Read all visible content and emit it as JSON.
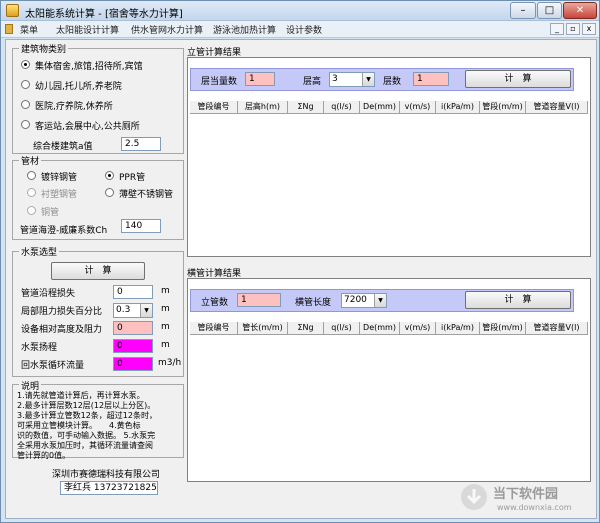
{
  "window": {
    "title": "太阳能系统计算 - [宿舍等水力计算]",
    "min": "–",
    "max": "□",
    "close": "✕"
  },
  "menu": [
    "菜单",
    "太阳能设计计算",
    "供水管网水力计算",
    "游泳池加热计算",
    "设计参数"
  ],
  "mdi": {
    "min": "_",
    "restore": "▫",
    "close": "x"
  },
  "building": {
    "title": "建筑物类别",
    "options": [
      "集体宿舍,旅馆,招待所,宾馆",
      "幼儿园,托儿所,养老院",
      "医院,疗养院,休养所",
      "客运站,会展中心,公共厕所"
    ],
    "selected": 0,
    "alpha_label": "综合楼建筑a值",
    "alpha_value": "2.5"
  },
  "pipe": {
    "title": "管材",
    "options": [
      "镀锌钢管",
      "PPR管",
      "衬塑钢管",
      "薄壁不锈钢管",
      "铜管"
    ],
    "selected": 1,
    "hw_label": "管道海澄-威廉系数Ch",
    "hw_value": "140"
  },
  "pump": {
    "title": "水泵选型",
    "calc_label": "计　算",
    "rows": [
      {
        "label": "管道沿程损失",
        "value": "0",
        "unit": "m"
      },
      {
        "label": "局部阻力损失百分比",
        "value": "0.3",
        "unit": "m"
      },
      {
        "label": "设备相对高度及阻力",
        "value": "0",
        "unit": "m"
      },
      {
        "label": "水泵扬程",
        "value": "0",
        "unit": "m"
      },
      {
        "label": "回水泵循环流量",
        "value": "0",
        "unit": "m3/h"
      }
    ]
  },
  "notes": {
    "title": "说明",
    "text": "1.请先就管道计算后，再计算水泵。\n2.最多计算层数12层(12层以上分区)。\n3.最多计算立管数12条，超过12条时，\n可采用立管模块计算。　　4.黄色标\n识的数值，可手动输入数据。 5.水泵完\n全采用水泵加压时，其循环流量请查阅\n管计算的0值。"
  },
  "company": "深圳市赛德瑞科技有限公司",
  "contact": "李红兵 13723721825",
  "riser": {
    "title": "立管计算结果",
    "floor_eq_label": "层当量数",
    "floor_eq_value": "1",
    "floor_h_label": "层高",
    "floor_h_value": "3",
    "floors_label": "层数",
    "floors_value": "1",
    "calc_label": "计　算",
    "columns": [
      "管段编号",
      "层高h(m)",
      "ΣNg",
      "q(l/s)",
      "De(mm)",
      "v(m/s)",
      "i(kPa/m)",
      "管段(m/m)",
      "管道容量V(l)"
    ]
  },
  "horiz": {
    "title": "横管计算结果",
    "risers_label": "立管数",
    "risers_value": "1",
    "len_label": "横管长度",
    "len_value": "7200",
    "calc_label": "计　算",
    "columns": [
      "管段编号",
      "管长(m/m)",
      "ΣNg",
      "q(l/s)",
      "De(mm)",
      "v(m/s)",
      "i(kPa/m)",
      "管段(m/m)",
      "管道容量V(l)"
    ]
  },
  "watermark": {
    "name": "当下软件园",
    "url": "www.downxia.com"
  },
  "colors": {
    "pink": "#ffc0c0",
    "magenta": "#ff00ff",
    "band": "#c5c9f7"
  }
}
